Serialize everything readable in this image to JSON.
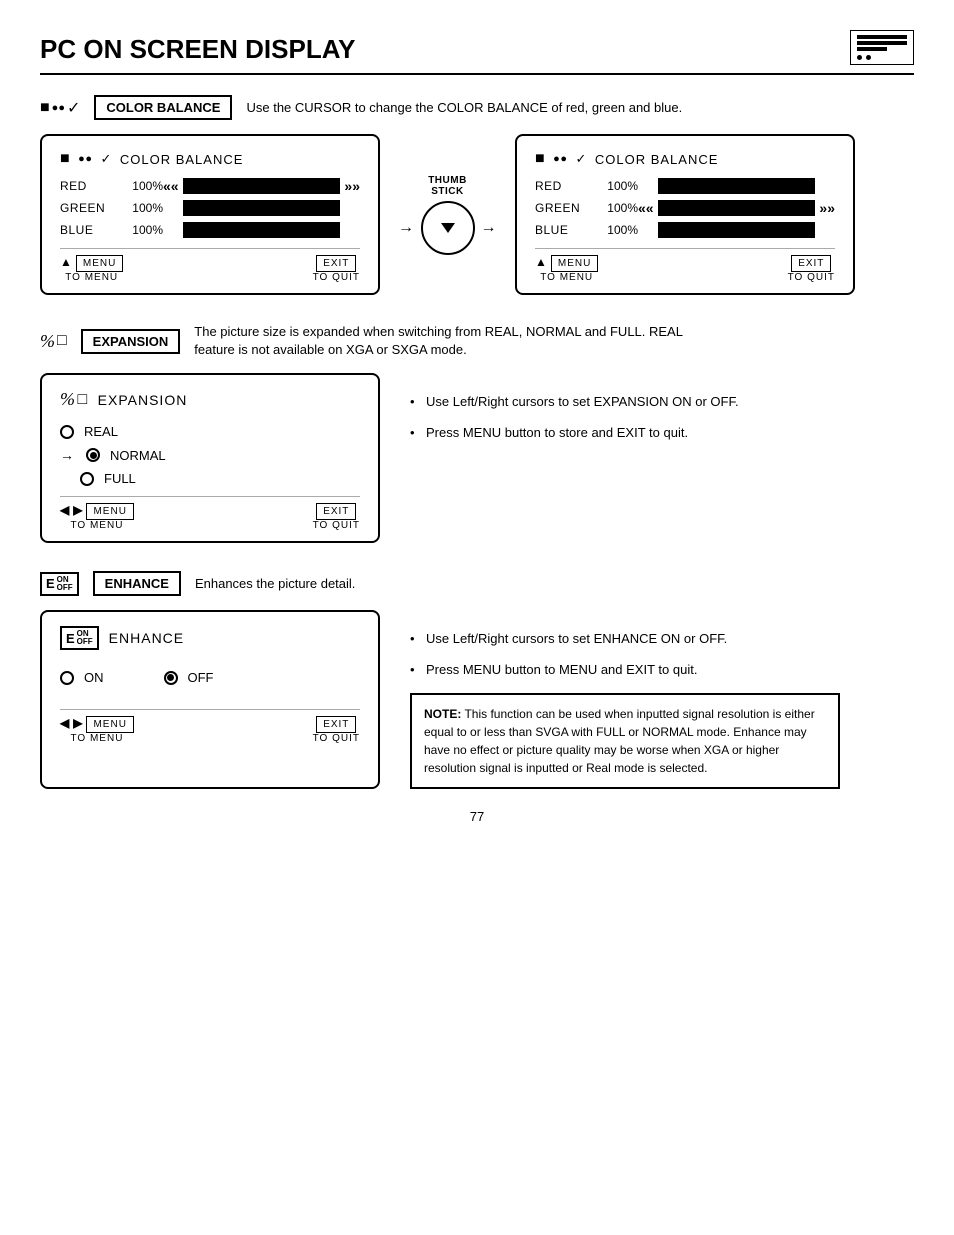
{
  "page": {
    "title": "PC ON SCREEN DISPLAY",
    "number": "77"
  },
  "color_balance": {
    "section_label": "COLOR BALANCE",
    "description": "Use the CURSOR to change the COLOR BALANCE of red, green and blue.",
    "thumb_stick_label": "THUMB\nSTICK",
    "left_panel": {
      "title": "COLOR BALANCE",
      "red_label": "RED",
      "red_pct": "100%",
      "green_label": "GREEN",
      "green_pct": "100%",
      "blue_label": "BLUE",
      "blue_pct": "100%",
      "menu_label": "MENU",
      "to_menu": "TO MENU",
      "exit_label": "EXIT",
      "to_quit": "TO QUIT",
      "active_row": "red"
    },
    "right_panel": {
      "title": "COLOR BALANCE",
      "red_label": "RED",
      "red_pct": "100%",
      "green_label": "GREEN",
      "green_pct": "100%",
      "blue_label": "BLUE",
      "blue_pct": "100%",
      "menu_label": "MENU",
      "to_menu": "TO MENU",
      "exit_label": "EXIT",
      "to_quit": "TO QUIT",
      "active_row": "green"
    }
  },
  "expansion": {
    "section_label": "EXPANSION",
    "description": "The picture size is expanded when switching from REAL, NORMAL and FULL.   REAL feature is not available on XGA or SXGA mode.",
    "box_title": "EXPANSION",
    "real_label": "REAL",
    "normal_label": "NORMAL",
    "full_label": "FULL",
    "selected": "NORMAL",
    "menu_label": "MENU",
    "to_menu": "TO MENU",
    "exit_label": "EXIT",
    "to_quit": "TO QUIT",
    "bullet1": "Use Left/Right cursors to set EXPANSION ON or OFF.",
    "bullet2": "Press MENU button to store and EXIT to quit."
  },
  "enhance": {
    "section_label": "ENHANCE",
    "description": "Enhances the picture detail.",
    "box_title": "ENHANCE",
    "on_label": "ON",
    "off_label": "OFF",
    "selected": "OFF",
    "menu_label": "MENU",
    "to_menu": "TO MENU",
    "exit_label": "EXIT",
    "to_quit": "TO QUIT",
    "bullet1": "Use Left/Right cursors to set ENHANCE ON or OFF.",
    "bullet2": "Press MENU button to MENU and EXIT to quit.",
    "note_label": "NOTE:",
    "note_text": "This function can be used when inputted signal resolution is either equal to or less than SVGA with FULL or NORMAL mode.  Enhance may have no effect or picture quality may be worse when XGA or higher resolution signal is inputted or Real mode is selected."
  }
}
